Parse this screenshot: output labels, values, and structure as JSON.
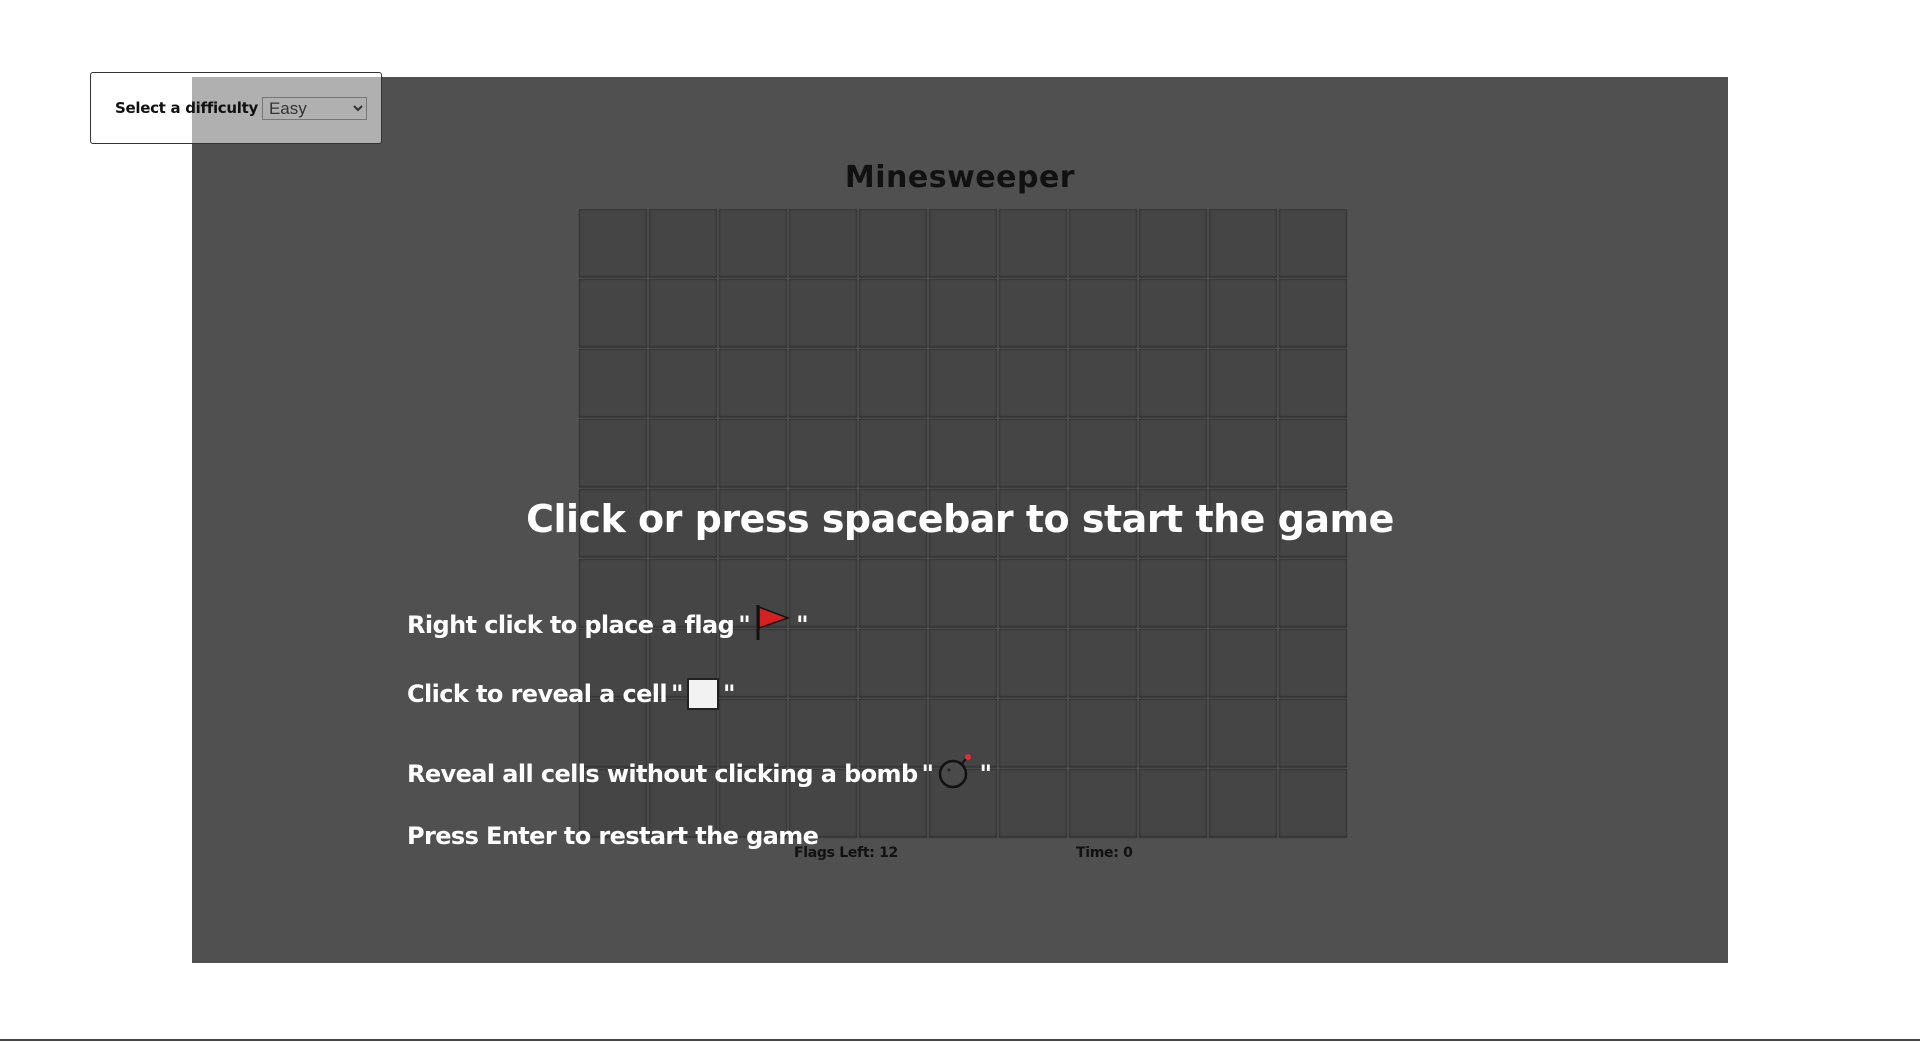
{
  "difficulty": {
    "label": "Select a difficulty",
    "selected": "Easy"
  },
  "game": {
    "title": "Minesweeper",
    "start_message": "Click or press spacebar to start the game",
    "board": {
      "rows": 9,
      "cols": 11
    },
    "instructions": {
      "flag": "Right click to place a flag",
      "reveal": "Click to reveal a cell",
      "goal": "Reveal all cells without clicking a bomb",
      "restart": "Press Enter to restart the game",
      "quote": "\""
    },
    "status": {
      "flags_left": "Flags Left: 12",
      "time": "Time: 0"
    }
  },
  "icons": {
    "flag": "flag-icon",
    "cell": "cell-icon",
    "bomb": "bomb-icon"
  },
  "colors": {
    "background": "#505050",
    "cell": "#454545",
    "flag": "#d42121"
  }
}
